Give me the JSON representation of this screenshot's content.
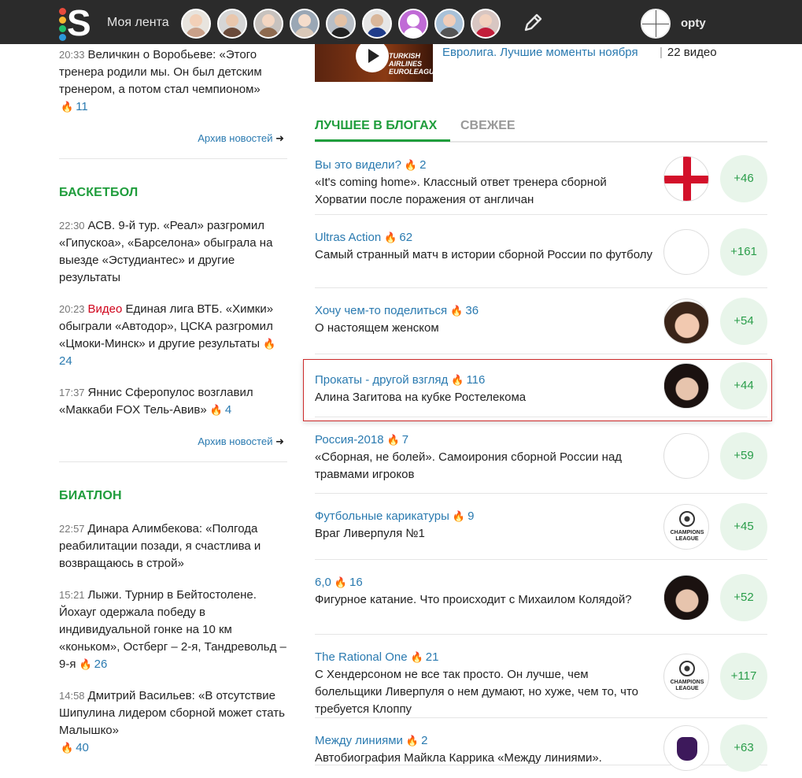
{
  "topbar": {
    "logo_letter": "S",
    "feed_label": "Моя лента",
    "username": "opty",
    "logo_dots": [
      "#e84a3c",
      "#f7b731",
      "#20bf6b",
      "#2d98da"
    ],
    "avatar_colors": [
      {
        "head": "#f2d0b8",
        "body": "#c9a089",
        "bg": "#e8e4de"
      },
      {
        "head": "#e9c7ad",
        "body": "#6a4a3a",
        "bg": "#d6d6d6"
      },
      {
        "head": "#f3d6c2",
        "body": "#8e6a4f",
        "bg": "#c7c2be"
      },
      {
        "head": "#f4dccb",
        "body": "#d9c8b8",
        "bg": "#9aa7b5"
      },
      {
        "head": "#e3c1a5",
        "body": "#222222",
        "bg": "#b8bec6"
      },
      {
        "head": "#d9b79a",
        "body": "#1f3c8a",
        "bg": "#e6e6e6"
      },
      {
        "head": "#ffffff",
        "body": "#ffffff",
        "bg": "#c06bd6"
      },
      {
        "head": "#f1cdb8",
        "body": "#555555",
        "bg": "#a8c1d8"
      },
      {
        "head": "#f2d2bf",
        "body": "#c21e3a",
        "bg": "#d8c6c2"
      }
    ]
  },
  "left": {
    "top_news": [
      {
        "time": "20:33",
        "text": "Величкин о Воробьеве: «Этого тренера родили мы. Он был детским тренером, а потом стал чемпионом»",
        "count": "11"
      }
    ],
    "archive_label": "Архив новостей",
    "basketball": {
      "title": "БАСКЕТБОЛ",
      "news": [
        {
          "time": "22:30",
          "video": "",
          "text": "АСВ. 9-й тур. «Реал» разгромил «Гипускоа», «Барселона» обыграла на выезде «Эстудиантес» и другие результаты",
          "count": ""
        },
        {
          "time": "20:23",
          "video": "Видео",
          "text": "Единая лига ВТБ. «Химки» обыграли «Автодор», ЦСКА разгромил «Цмоки-Минск» и другие результаты",
          "count": "24"
        },
        {
          "time": "17:37",
          "video": "",
          "text": "Яннис Сферопулос возглавил «Маккаби FOX Тель-Авив»",
          "count": "4"
        }
      ]
    },
    "biathlon": {
      "title": "БИАТЛОН",
      "news": [
        {
          "time": "22:57",
          "text": "Динара Алимбекова: «Полгода реабилитации позади, я счастлива и возвращаюсь в строй»",
          "count": ""
        },
        {
          "time": "15:21",
          "text": "Лыжи. Турнир в Бейтостолене. Йохауг одержала победу в индивидуальной гонке на 10 км «коньком», Остберг – 2-я, Тандревольд – 9-я",
          "count": "26"
        },
        {
          "time": "14:58",
          "text": "Дмитрий Васильев: «В отсутствие Шипулина лидером сборной может стать Малышко»",
          "count": "40"
        }
      ]
    }
  },
  "video": {
    "brand": "TURKISH AIRLINES EUROLEAGUE",
    "title": "Евролига. Лучшие моменты ноября",
    "count": "22 видео"
  },
  "tabs": {
    "best": "ЛУЧШЕЕ В БЛОГАХ",
    "fresh": "СВЕЖЕЕ"
  },
  "blogs": [
    {
      "name": "Вы это видели?",
      "count": "2",
      "desc": "«It's coming home». Классный ответ тренера сборной Хорватии после поражения от англичан",
      "score": "+46",
      "pic": "flag-eng"
    },
    {
      "name": "Ultras Action",
      "count": "62",
      "desc": "Самый странный матч в истории сборной России по футболу",
      "score": "+161",
      "pic": "flag-rus"
    },
    {
      "name": "Хочу чем-то поделиться",
      "count": "36",
      "desc": "О настоящем женском",
      "score": "+54",
      "pic": "portrait"
    },
    {
      "name": "Прокаты - другой взгляд",
      "count": "116",
      "desc": "Алина Загитова на кубке Ростелекома",
      "score": "+44",
      "pic": "portrait-dark"
    },
    {
      "name": "Россия-2018",
      "count": "7",
      "desc": "«Сборная, не болей». Самоирония сборной России над травмами игроков",
      "score": "+59",
      "pic": "flag-rus"
    },
    {
      "name": "Футбольные карикатуры",
      "count": "9",
      "desc": "Враг Ливерпуля №1",
      "score": "+45",
      "pic": "ucl"
    },
    {
      "name": "6,0",
      "count": "16",
      "desc": "Фигурное катание. Что происходит с Михаилом Колядой?",
      "score": "+52",
      "pic": "portrait-dark"
    },
    {
      "name": "The Rational One",
      "count": "21",
      "desc": "С Хендерсоном не все так просто. Он лучше, чем болельщики Ливерпуля о нем думают, но хуже, чем то, что требуется Клоппу",
      "score": "+117",
      "pic": "ucl"
    },
    {
      "name": "Между линиями",
      "count": "2",
      "desc": "Автобиография Майкла Каррика «Между линиями».",
      "score": "+63",
      "pic": "pl"
    }
  ],
  "ucl_label": "CHAMPIONS LEAGUE"
}
